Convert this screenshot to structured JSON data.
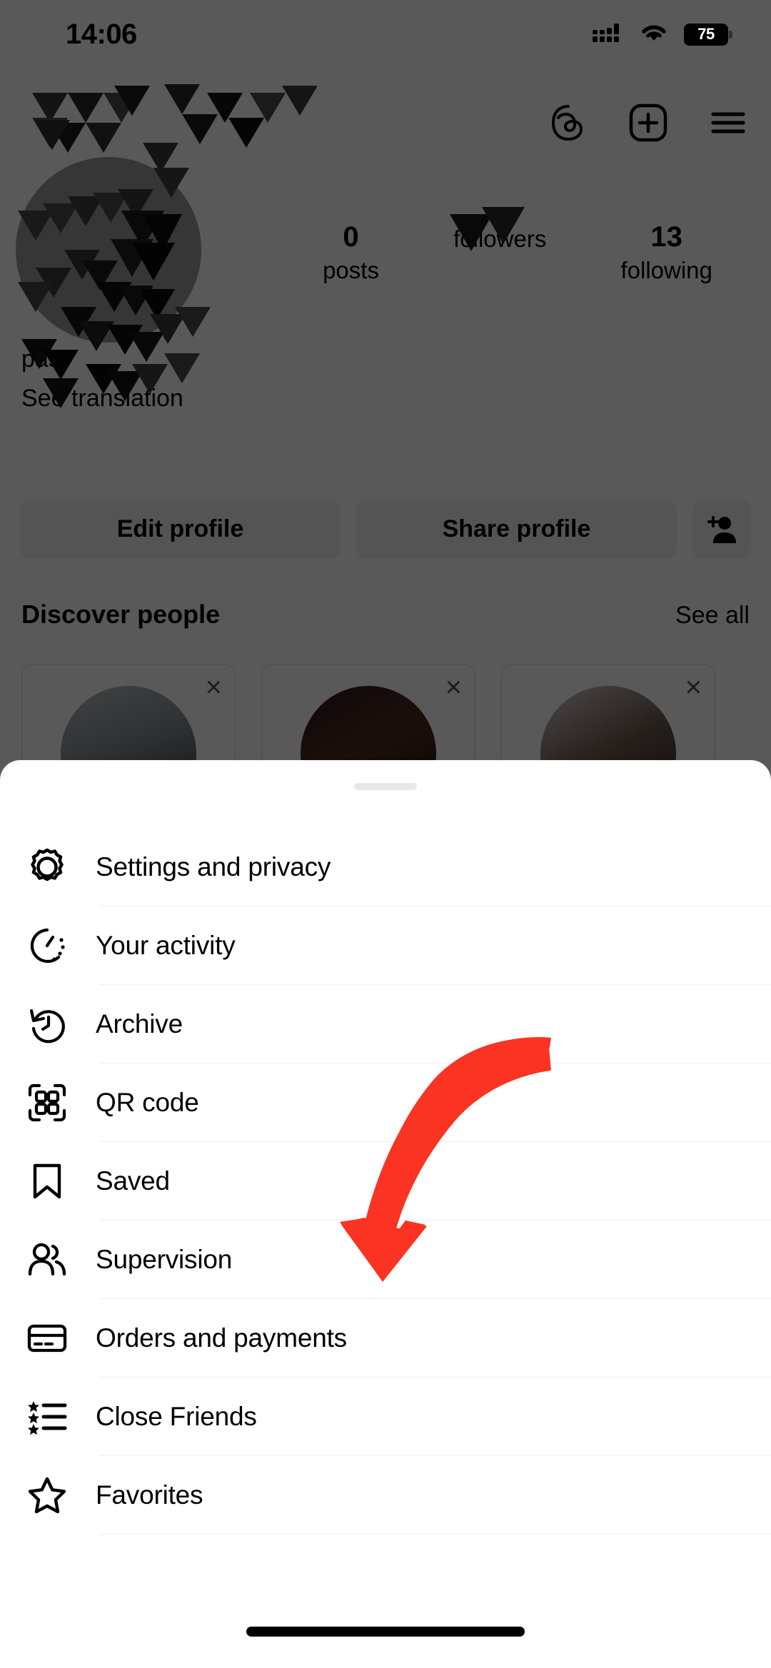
{
  "status_bar": {
    "time": "14:06",
    "battery_level": "75",
    "battery_percent": 75,
    "icons": [
      "cellular-signal-icon",
      "wifi-icon",
      "battery-icon"
    ]
  },
  "top_nav": {
    "items": [
      {
        "name": "threads-icon",
        "label": "Threads"
      },
      {
        "name": "new-post-icon",
        "label": "New post"
      },
      {
        "name": "hamburger-menu-icon",
        "label": "Menu"
      }
    ]
  },
  "profile": {
    "stats": [
      {
        "value": "0",
        "label": "posts"
      },
      {
        "value": "",
        "label": "followers"
      },
      {
        "value": "13",
        "label": "following"
      }
    ],
    "bio_text": "past",
    "see_translation": "See translation",
    "buttons": {
      "edit_profile": "Edit profile",
      "share_profile": "Share profile",
      "add_person_icon": "add-person-icon"
    }
  },
  "discover": {
    "title": "Discover people",
    "see_all": "See all",
    "cards": [
      {
        "dismiss": "×"
      },
      {
        "dismiss": "×"
      },
      {
        "dismiss": "×"
      }
    ]
  },
  "sheet": {
    "handle": "drag-handle",
    "menu_items": [
      {
        "icon": "gear-icon",
        "label": "Settings and privacy"
      },
      {
        "icon": "activity-clock-icon",
        "label": "Your activity"
      },
      {
        "icon": "archive-clock-icon",
        "label": "Archive"
      },
      {
        "icon": "qr-code-icon",
        "label": "QR code"
      },
      {
        "icon": "bookmark-icon",
        "label": "Saved"
      },
      {
        "icon": "people-icon",
        "label": "Supervision"
      },
      {
        "icon": "credit-card-icon",
        "label": "Orders and payments"
      },
      {
        "icon": "star-list-icon",
        "label": "Close Friends"
      },
      {
        "icon": "star-icon",
        "label": "Favorites"
      }
    ]
  },
  "annotation": {
    "type": "curved-down-arrow",
    "color": "#FA3322",
    "points_to": "Orders and payments"
  },
  "colors": {
    "accent_red": "#FA3322",
    "sheet_background": "#FFFFFF",
    "divider": "#EFEFEF",
    "button_background": "#EFEFEF",
    "dim_overlay": "rgba(0,0,0,0.65)"
  }
}
